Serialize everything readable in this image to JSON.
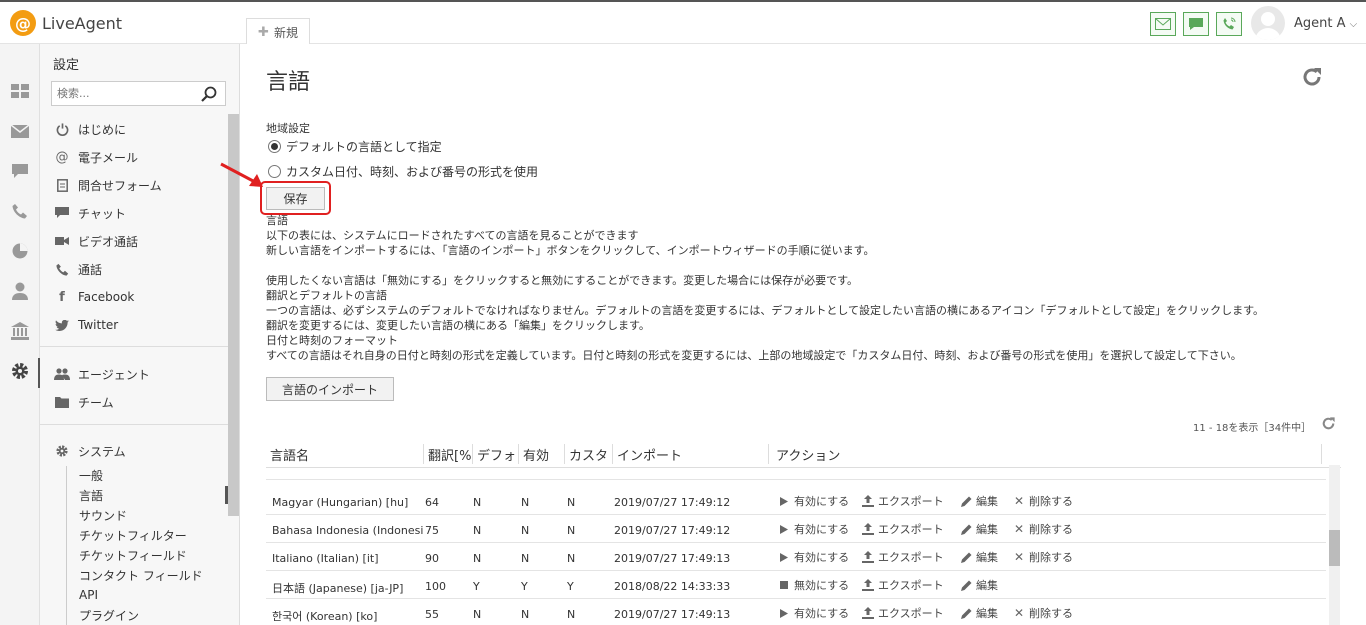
{
  "app": {
    "logo_letter": "@",
    "logo_text": "LiveAgent",
    "new_tab": "新規",
    "agent_name": "Agent A"
  },
  "sidebar": {
    "title": "設定",
    "search_placeholder": "検索...",
    "items": [
      {
        "label": "はじめに",
        "icon": "power-icon"
      },
      {
        "label": "電子メール",
        "icon": "at-icon"
      },
      {
        "label": "問合せフォーム",
        "icon": "form-icon"
      },
      {
        "label": "チャット",
        "icon": "chat-icon"
      },
      {
        "label": "ビデオ通話",
        "icon": "video-icon"
      },
      {
        "label": "通話",
        "icon": "phone-icon"
      },
      {
        "label": "Facebook",
        "icon": "facebook-icon"
      },
      {
        "label": "Twitter",
        "icon": "twitter-icon"
      }
    ],
    "group2": [
      {
        "label": "エージェント",
        "icon": "agents-icon"
      },
      {
        "label": "チーム",
        "icon": "folder-icon"
      }
    ],
    "system": {
      "label": "システム",
      "subitems": [
        "一般",
        "言語",
        "サウンド",
        "チケットフィルター",
        "チケットフィールド",
        "コンタクト フィールド",
        "API",
        "プラグイン"
      ],
      "active": "言語"
    }
  },
  "main": {
    "title": "言語",
    "region_label": "地域設定",
    "radio_default": "デフォルトの言語として指定",
    "radio_custom": "カスタム日付、時刻、および番号の形式を使用",
    "save_button": "保存",
    "desc": [
      "言語",
      "以下の表には、システムにロードされたすべての言語を見ることができます",
      "新しい言語をインポートするには、「言語のインポート」ボタンをクリックして、インポートウィザードの手順に従います。",
      "",
      "使用したくない言語は「無効にする」をクリックすると無効にすることができます。変更した場合には保存が必要です。",
      "翻訳とデフォルトの言語",
      "一つの言語は、必ずシステムのデフォルトでなければなりません。デフォルトの言語を変更するには、デフォルトとして設定したい言語の横にあるアイコン「デフォルトとして設定」をクリックします。",
      "翻訳を変更するには、変更したい言語の横にある「編集」をクリックします。",
      "日付と時刻のフォーマット",
      "すべての言語はそれ自身の日付と時刻の形式を定義しています。日付と時刻の形式を変更するには、上部の地域設定で「カスタム日付、時刻、および番号の形式を使用」を選択して設定して下さい。"
    ],
    "import_button": "言語のインポート",
    "pager": "11 - 18を表示［34件中］"
  },
  "table": {
    "headers": [
      "言語名",
      "翻訳[%",
      "デフォ",
      "有効",
      "カスタ",
      "インポート",
      "アクション"
    ],
    "rows": [
      {
        "name": "Magyar (Hungarian) [hu]",
        "pct": "64",
        "def": "N",
        "enabled": "N",
        "custom": "N",
        "imported": "2019/07/27 17:49:12",
        "toggle": "有効にする",
        "toggle_icon": "play-icon",
        "export": "エクスポート",
        "edit": "編集",
        "delete": "削除する"
      },
      {
        "name": "Bahasa Indonesia (Indonesian)",
        "pct": "75",
        "def": "N",
        "enabled": "N",
        "custom": "N",
        "imported": "2019/07/27 17:49:12",
        "toggle": "有効にする",
        "toggle_icon": "play-icon",
        "export": "エクスポート",
        "edit": "編集",
        "delete": "削除する"
      },
      {
        "name": "Italiano (Italian) [it]",
        "pct": "90",
        "def": "N",
        "enabled": "N",
        "custom": "N",
        "imported": "2019/07/27 17:49:13",
        "toggle": "有効にする",
        "toggle_icon": "play-icon",
        "export": "エクスポート",
        "edit": "編集",
        "delete": "削除する"
      },
      {
        "name": "日本語 (Japanese) [ja-JP]",
        "pct": "100",
        "def": "Y",
        "enabled": "Y",
        "custom": "Y",
        "imported": "2018/08/22 14:33:33",
        "toggle": "無効にする",
        "toggle_icon": "stop-icon",
        "export": "エクスポート",
        "edit": "編集",
        "delete": ""
      },
      {
        "name": "한국어 (Korean) [ko]",
        "pct": "55",
        "def": "N",
        "enabled": "N",
        "custom": "N",
        "imported": "2019/07/27 17:49:13",
        "toggle": "有効にする",
        "toggle_icon": "play-icon",
        "export": "エクスポート",
        "edit": "編集",
        "delete": "削除する"
      }
    ]
  },
  "colors": {
    "accent_green": "#5aa85a",
    "highlight_red": "#e02020",
    "logo_orange": "#f39c12"
  }
}
